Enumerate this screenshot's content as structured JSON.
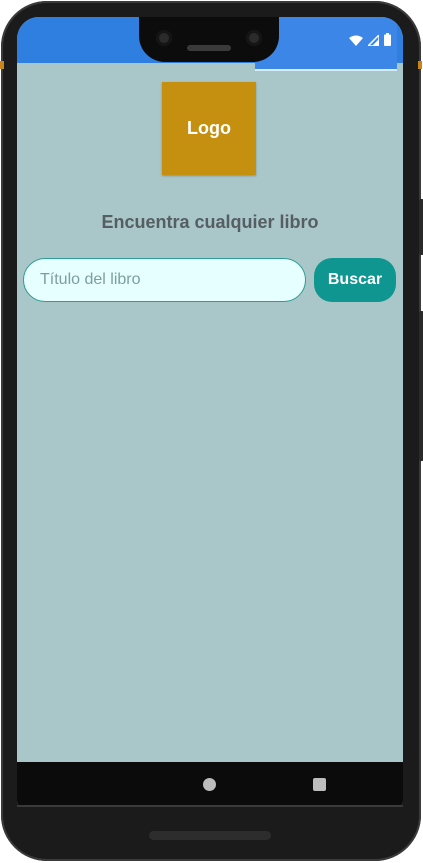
{
  "status_bar": {
    "icons": [
      "wifi-icon",
      "cell-signal-icon",
      "battery-icon"
    ]
  },
  "logo": {
    "label": "Logo"
  },
  "heading": {
    "text": "Encuentra cualquier libro"
  },
  "search": {
    "placeholder": "Título del libro",
    "value": "",
    "button_label": "Buscar"
  },
  "navigation_bar": {
    "icons": [
      "home-icon",
      "recents-icon"
    ]
  },
  "colors": {
    "screen_bg": "#a9c6c8",
    "status_bar": "#2f7fe0",
    "logo_bg": "#c58f0f",
    "button_bg": "#0f9690",
    "input_bg": "#e6ffff",
    "heading_text": "#555f63"
  }
}
